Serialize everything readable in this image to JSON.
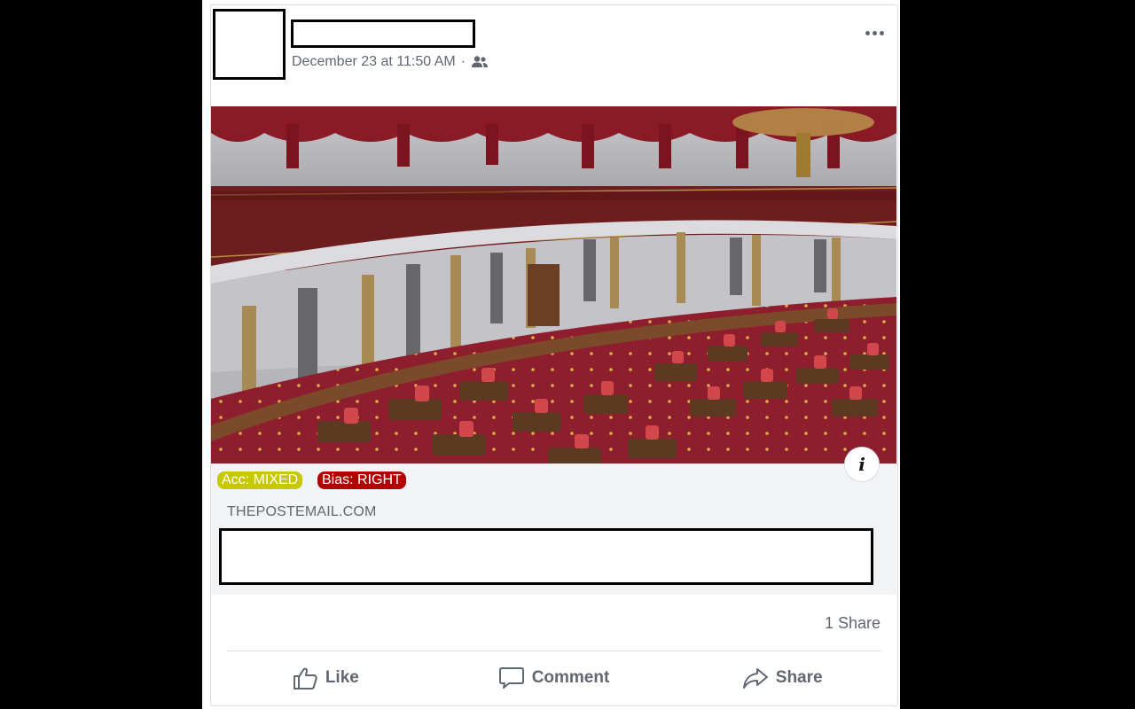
{
  "post": {
    "timestamp": "December 23 at 11:50 AM",
    "separator": "·",
    "audience_icon": "friends-icon",
    "more_icon": "more-horizontal-icon"
  },
  "image": {
    "subject": "legislative-chamber-photo",
    "info_label": "i"
  },
  "badges": {
    "accuracy": "Acc: MIXED",
    "bias": "Bias: RIGHT",
    "accuracy_color": "#c8c800",
    "bias_color": "#b30000"
  },
  "link": {
    "domain": "THEPOSTEMAIL.COM"
  },
  "engagement": {
    "shares": "1 Share"
  },
  "actions": {
    "like": "Like",
    "comment": "Comment",
    "share": "Share"
  }
}
